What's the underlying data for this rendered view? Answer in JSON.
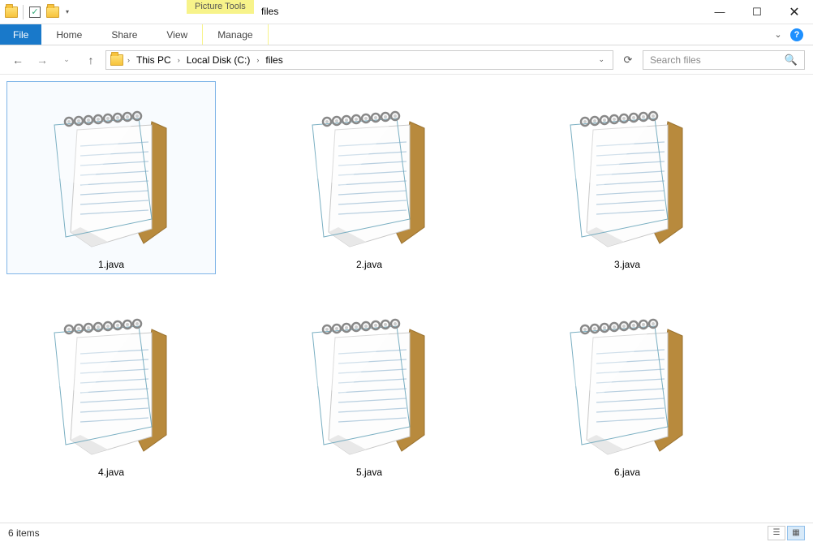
{
  "window": {
    "title": "files",
    "contextual_tab": "Picture Tools"
  },
  "ribbon": {
    "file": "File",
    "home": "Home",
    "share": "Share",
    "view": "View",
    "manage": "Manage"
  },
  "breadcrumb": {
    "segments": [
      "This PC",
      "Local Disk (C:)",
      "files"
    ]
  },
  "search": {
    "placeholder": "Search files"
  },
  "files": [
    {
      "name": "1.java",
      "selected": true
    },
    {
      "name": "2.java",
      "selected": false
    },
    {
      "name": "3.java",
      "selected": false
    },
    {
      "name": "4.java",
      "selected": false
    },
    {
      "name": "5.java",
      "selected": false
    },
    {
      "name": "6.java",
      "selected": false
    }
  ],
  "status": {
    "item_count": "6 items"
  }
}
